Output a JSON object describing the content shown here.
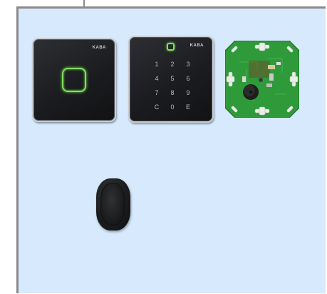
{
  "colors": {
    "canvas_background": "#d6e9fd",
    "led_green": "#7ee25a",
    "pcb_green": "#2f9a3a",
    "device_black": "#1b1c1f"
  },
  "devices": {
    "card_reader": {
      "brand": "KABA",
      "icon": "rfid-square-icon"
    },
    "keypad_reader": {
      "brand": "KABA",
      "icon": "rfid-square-icon",
      "keys": [
        "1",
        "2",
        "3",
        "4",
        "5",
        "6",
        "7",
        "8",
        "9",
        "C",
        "0",
        "E"
      ]
    },
    "circuit_board": {
      "icon": "pcb-icon"
    },
    "cylinder_knob": {
      "icon": "knob-icon"
    }
  }
}
